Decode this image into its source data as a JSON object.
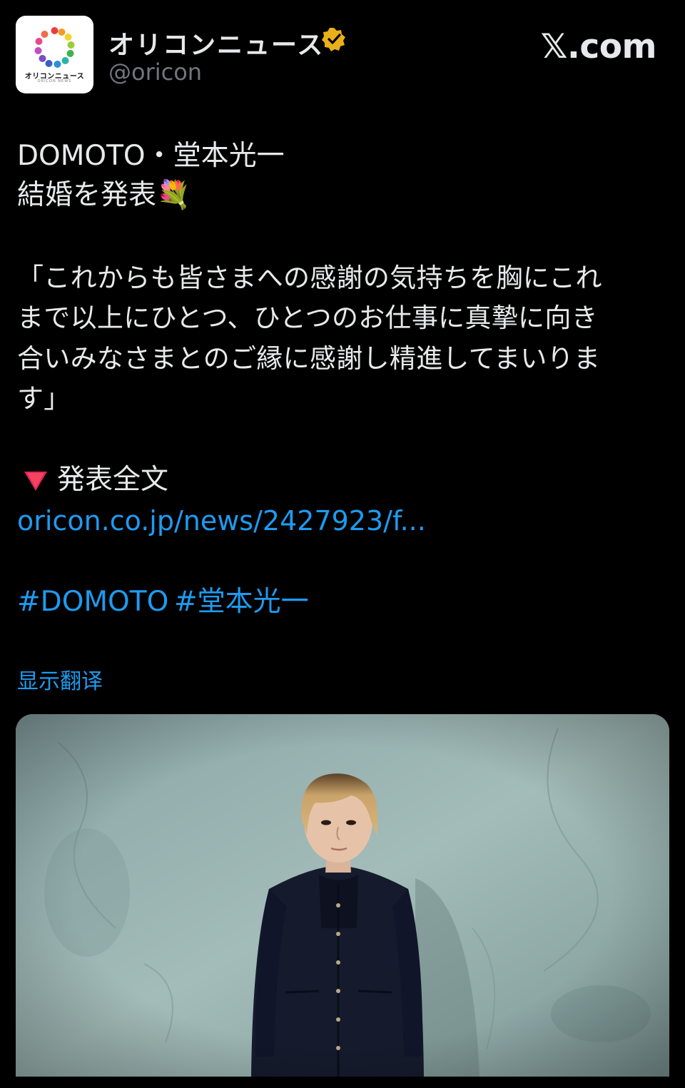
{
  "account": {
    "display_name": "オリコンニュース",
    "handle": "@oricon",
    "avatar_text": "オリコンニュース",
    "avatar_subtext": "ORICON NEWS",
    "verified_color": "#e8b019"
  },
  "brand": {
    "site_label": "𝕏.com"
  },
  "post": {
    "line1": "DOMOTO・堂本光一",
    "line2": "結婚を発表💐",
    "quote_lines": [
      "「これからも皆さまへの感謝の気持ちを胸にこれ",
      "まで以上にひとつ、ひとつのお仕事に真摯に向き",
      "合いみなさまとのご縁に感謝し精進してまいりま",
      "す」"
    ],
    "full_text_label": "発表全文",
    "link": "oricon.co.jp/news/2427923/f...",
    "hashtags": [
      "#DOMOTO",
      "#堂本光一"
    ],
    "translate_label": "显示翻译"
  },
  "colors": {
    "background": "#000000",
    "text": "#e7e9ea",
    "secondary": "#6e767d",
    "link": "#1d9bf0",
    "triangle": "#e0245e"
  },
  "media": {
    "description_icon": "photo-person-portrait"
  }
}
